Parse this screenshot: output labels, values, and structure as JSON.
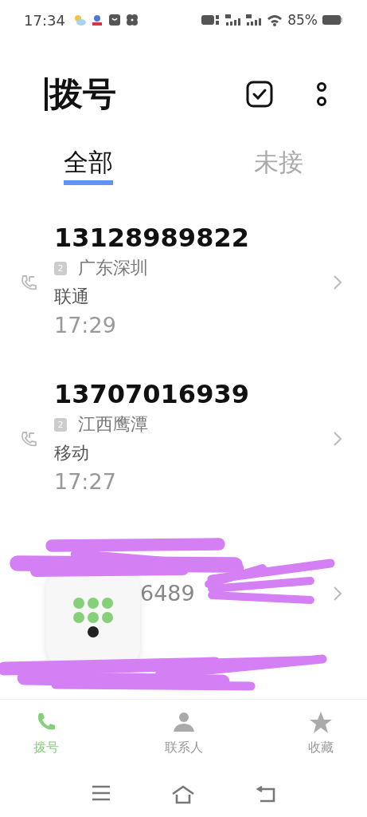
{
  "status_bar": {
    "time": "17:34",
    "battery": "85%"
  },
  "header": {
    "title": "拨号"
  },
  "tabs": [
    {
      "label": "全部",
      "selected": true
    },
    {
      "label": "未接",
      "selected": false
    }
  ],
  "calls": [
    {
      "kind": "full",
      "number": "13128989822",
      "sim": "2",
      "location": "广东深圳",
      "carrier": "联通",
      "time": "17:29"
    },
    {
      "kind": "full",
      "number": "13707016939",
      "sim": "2",
      "location": "江西鹰潭",
      "carrier": "移动",
      "time": "17:27"
    },
    {
      "kind": "obscured",
      "detail": "6489"
    }
  ],
  "bottom_nav": [
    {
      "label": "拨号",
      "selected": true
    },
    {
      "label": "联系人",
      "selected": false
    },
    {
      "label": "收藏",
      "selected": false
    }
  ]
}
